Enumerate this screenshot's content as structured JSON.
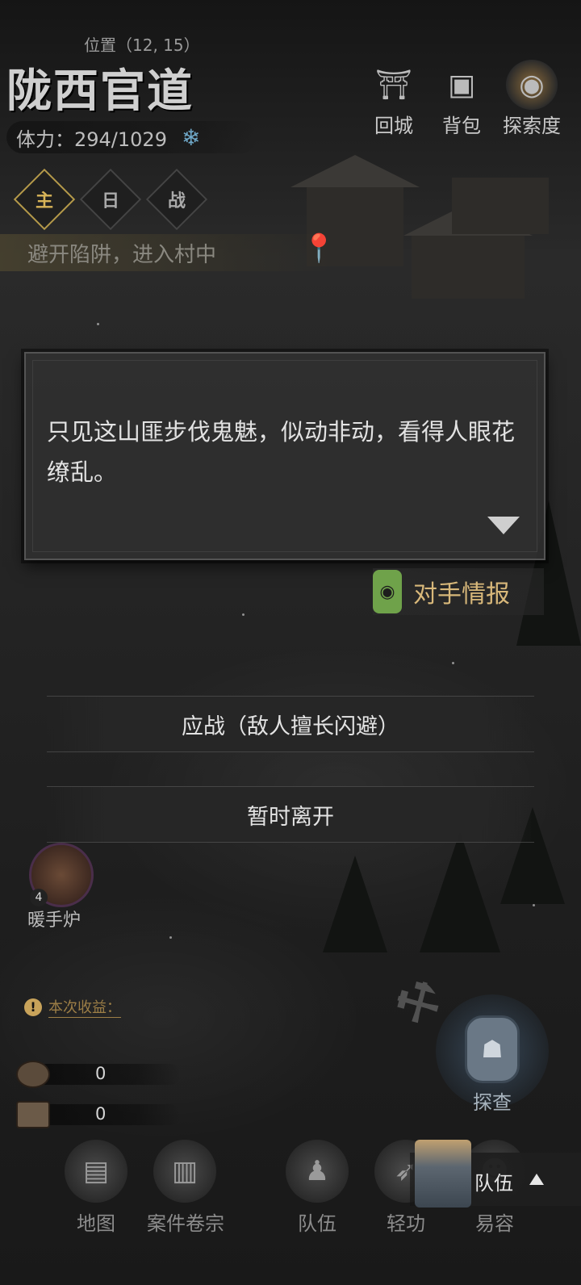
{
  "header": {
    "area_name": "陇西官道",
    "position_label": "位置（12, 15）",
    "stamina": "体力：294/1029"
  },
  "top_buttons": [
    {
      "label": "回城",
      "icon": "city-gate-icon"
    },
    {
      "label": "背包",
      "icon": "bundle-icon"
    },
    {
      "label": "探索度",
      "icon": "lantern-icon"
    }
  ],
  "quest_tabs": [
    {
      "label": "主",
      "icon": "main-quest-icon",
      "active": true
    },
    {
      "label": "日",
      "icon": "daily-quest-icon",
      "active": false
    },
    {
      "label": "战",
      "icon": "battle-quest-icon",
      "active": false
    }
  ],
  "objective": {
    "text": "避开陷阱，进入村中"
  },
  "dialog": {
    "text": "只见这山匪步伐鬼魅，似动非动，看得人眼花缭乱。"
  },
  "intel_button": {
    "label": "对手情报"
  },
  "choices": [
    {
      "label": "应战（敌人擅长闪避）"
    },
    {
      "label": "暂时离开"
    }
  ],
  "item": {
    "label": "暖手炉",
    "count": "4"
  },
  "earnings": {
    "label": "本次收益："
  },
  "resources": [
    {
      "icon": "coin-icon",
      "value": "0"
    },
    {
      "icon": "ticket-icon",
      "value": "0"
    }
  ],
  "investigate": {
    "label": "探查"
  },
  "nav": [
    {
      "label": "地图",
      "icon": "map-scroll-icon"
    },
    {
      "label": "案件卷宗",
      "icon": "case-file-icon"
    },
    {
      "label": "队伍",
      "icon": "team-icon"
    },
    {
      "label": "轻功",
      "icon": "qinggong-icon"
    },
    {
      "label": "易容",
      "icon": "disguise-icon"
    }
  ],
  "team_popup": {
    "label": "队伍"
  },
  "colors": {
    "accent_gold": "#d8b458",
    "intel_text": "#d8b87a",
    "lantern_green": "#6fa24a"
  }
}
